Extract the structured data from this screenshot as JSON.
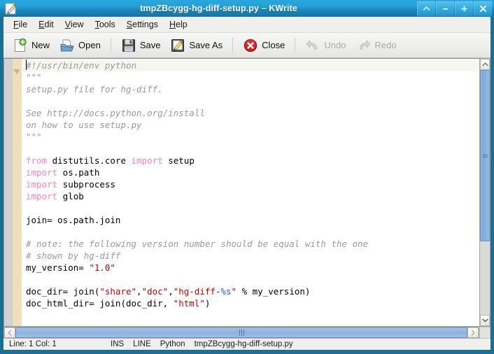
{
  "window": {
    "title": "tmpZBcygg-hg-diff-setup.py – KWrite",
    "icon": "kwrite-document-pencil-icon",
    "buttons": [
      {
        "name": "keep-above-button",
        "glyph": "^",
        "label": "Keep Above Others"
      },
      {
        "name": "minimize-button",
        "glyph": "–",
        "label": "Minimize"
      },
      {
        "name": "maximize-button",
        "glyph": "+",
        "label": "Maximize"
      },
      {
        "name": "close-button",
        "glyph": "✕",
        "label": "Close"
      }
    ]
  },
  "menubar": {
    "items": [
      {
        "name": "menu-file",
        "label": "File",
        "accel": "F"
      },
      {
        "name": "menu-edit",
        "label": "Edit",
        "accel": "E"
      },
      {
        "name": "menu-view",
        "label": "View",
        "accel": "V"
      },
      {
        "name": "menu-tools",
        "label": "Tools",
        "accel": "T"
      },
      {
        "name": "menu-settings",
        "label": "Settings",
        "accel": "S"
      },
      {
        "name": "menu-help",
        "label": "Help",
        "accel": "H"
      }
    ]
  },
  "toolbar": {
    "new_label": "New",
    "open_label": "Open",
    "save_label": "Save",
    "save_as_label": "Save As",
    "close_label": "Close",
    "undo_label": "Undo",
    "redo_label": "Redo",
    "icons": {
      "new": "new-document-icon",
      "open": "open-folder-icon",
      "save": "floppy-disk-icon",
      "save_as": "floppy-disk-pencil-icon",
      "close": "red-x-circle-icon",
      "undo": "undo-arrow-icon",
      "redo": "redo-arrow-icon"
    },
    "disabled": [
      "Undo",
      "Redo"
    ]
  },
  "editor": {
    "language": "Python",
    "current_line": 1,
    "lines": [
      {
        "n": 1,
        "tokens": [
          {
            "t": "comment",
            "s": "#!/usr/bin/env python"
          }
        ]
      },
      {
        "n": 2,
        "tokens": [
          {
            "t": "comment",
            "s": "\"\"\""
          }
        ]
      },
      {
        "n": 3,
        "tokens": [
          {
            "t": "comment",
            "s": "setup.py file for hg-diff."
          }
        ]
      },
      {
        "n": 4,
        "tokens": [
          {
            "t": "comment",
            "s": ""
          }
        ]
      },
      {
        "n": 5,
        "tokens": [
          {
            "t": "comment",
            "s": "See http://docs.python.org/install"
          }
        ]
      },
      {
        "n": 6,
        "tokens": [
          {
            "t": "comment",
            "s": "on how to use setup.py"
          }
        ]
      },
      {
        "n": 7,
        "tokens": [
          {
            "t": "comment",
            "s": "\"\"\""
          }
        ]
      },
      {
        "n": 8,
        "tokens": [
          {
            "t": "plain",
            "s": ""
          }
        ]
      },
      {
        "n": 9,
        "tokens": [
          {
            "t": "keyword",
            "s": "from"
          },
          {
            "t": "plain",
            "s": " distutils.core "
          },
          {
            "t": "keyword",
            "s": "import"
          },
          {
            "t": "plain",
            "s": " setup"
          }
        ]
      },
      {
        "n": 10,
        "tokens": [
          {
            "t": "keyword",
            "s": "import"
          },
          {
            "t": "plain",
            "s": " os.path"
          }
        ]
      },
      {
        "n": 11,
        "tokens": [
          {
            "t": "keyword",
            "s": "import"
          },
          {
            "t": "plain",
            "s": " subprocess"
          }
        ]
      },
      {
        "n": 12,
        "tokens": [
          {
            "t": "keyword",
            "s": "import"
          },
          {
            "t": "plain",
            "s": " glob"
          }
        ]
      },
      {
        "n": 13,
        "tokens": [
          {
            "t": "plain",
            "s": ""
          }
        ]
      },
      {
        "n": 14,
        "tokens": [
          {
            "t": "plain",
            "s": "join= os.path.join"
          }
        ]
      },
      {
        "n": 15,
        "tokens": [
          {
            "t": "plain",
            "s": ""
          }
        ]
      },
      {
        "n": 16,
        "tokens": [
          {
            "t": "comment",
            "s": "# note: the following version number should be equal with the one"
          }
        ]
      },
      {
        "n": 17,
        "tokens": [
          {
            "t": "comment",
            "s": "# shown by hg-diff"
          }
        ]
      },
      {
        "n": 18,
        "tokens": [
          {
            "t": "plain",
            "s": "my_version= "
          },
          {
            "t": "string",
            "s": "\"1.0\""
          }
        ]
      },
      {
        "n": 19,
        "tokens": [
          {
            "t": "plain",
            "s": ""
          }
        ]
      },
      {
        "n": 20,
        "tokens": [
          {
            "t": "plain",
            "s": "doc_dir= join("
          },
          {
            "t": "string",
            "s": "\"share\""
          },
          {
            "t": "plain",
            "s": ","
          },
          {
            "t": "string",
            "s": "\"doc\""
          },
          {
            "t": "plain",
            "s": ","
          },
          {
            "t": "string",
            "s": "\"hg-diff-"
          },
          {
            "t": "fmt",
            "s": "%s"
          },
          {
            "t": "string",
            "s": "\""
          },
          {
            "t": "plain",
            "s": " % my_version)"
          }
        ]
      },
      {
        "n": 21,
        "tokens": [
          {
            "t": "plain",
            "s": "doc_html_dir= join(doc_dir, "
          },
          {
            "t": "string",
            "s": "\"html\""
          },
          {
            "t": "plain",
            "s": ")"
          }
        ]
      },
      {
        "n": 22,
        "tokens": [
          {
            "t": "plain",
            "s": ""
          }
        ]
      }
    ]
  },
  "scrollbars": {
    "vertical": {
      "thumb_percent": 70,
      "up_glyph": "▲",
      "down_glyph": "▼"
    },
    "horizontal": {
      "left_glyph": "‹",
      "right_glyph": "›"
    }
  },
  "statusbar": {
    "position": "Line: 1 Col: 1",
    "insert_mode": "INS",
    "selection_mode": "LINE",
    "highlight_mode": "Python",
    "document_name": "tmpZBcygg-hg-diff-setup.py"
  },
  "colors": {
    "titlebar": "#24a0d8",
    "frame": "#1c6f94",
    "comment": "#9a9a9a",
    "keyword": "#ff7fbf",
    "string": "#c30000",
    "format_spec": "#1560cf",
    "scrollbar_thumb": "#8cb2dd",
    "fold_column": "#eddfbc"
  }
}
